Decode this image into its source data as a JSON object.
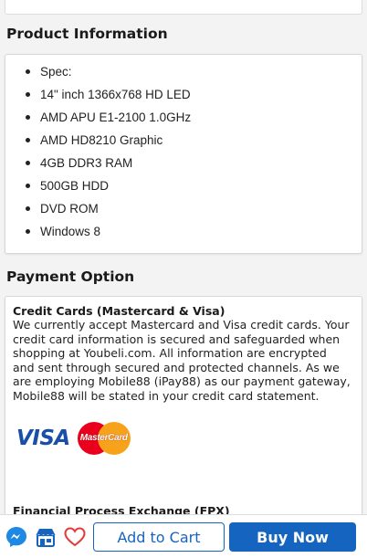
{
  "product_info": {
    "title": "Product Information",
    "specs": [
      "Spec:",
      "14\" inch 1366x768 HD LED",
      "AMD APU E1-2100 1.0GHz",
      "AMD HD8210 Graphic",
      "4GB DDR3 RAM",
      "500GB HDD",
      "DVD ROM",
      "Windows 8"
    ]
  },
  "payment": {
    "title": "Payment Option",
    "credit_heading": "Credit Cards (Mastercard & Visa)",
    "credit_text": "We currently accept Mastercard and Visa credit cards. Your credit card information is secured and safeguarded when shopping at Youbeli.com. All information are encrypted and sent through secured and protected channels. As we are employing Mobile88 (iPay88) as our payment gateway, Mobile88 will be stated in your credit card statement.",
    "visa_logo": "VISA",
    "mastercard_logo": "MasterCard",
    "fpx_heading": "Financial Process Exchange (FPX)"
  },
  "bottom_bar": {
    "messenger_icon": "messenger-icon",
    "store_icon": "store-icon",
    "wishlist_icon": "heart-icon",
    "add_to_cart_label": "Add to Cart",
    "buy_now_label": "Buy Now"
  },
  "colors": {
    "accent": "#1565c0",
    "messenger": "#1e88e5",
    "heart": "#e53935"
  }
}
